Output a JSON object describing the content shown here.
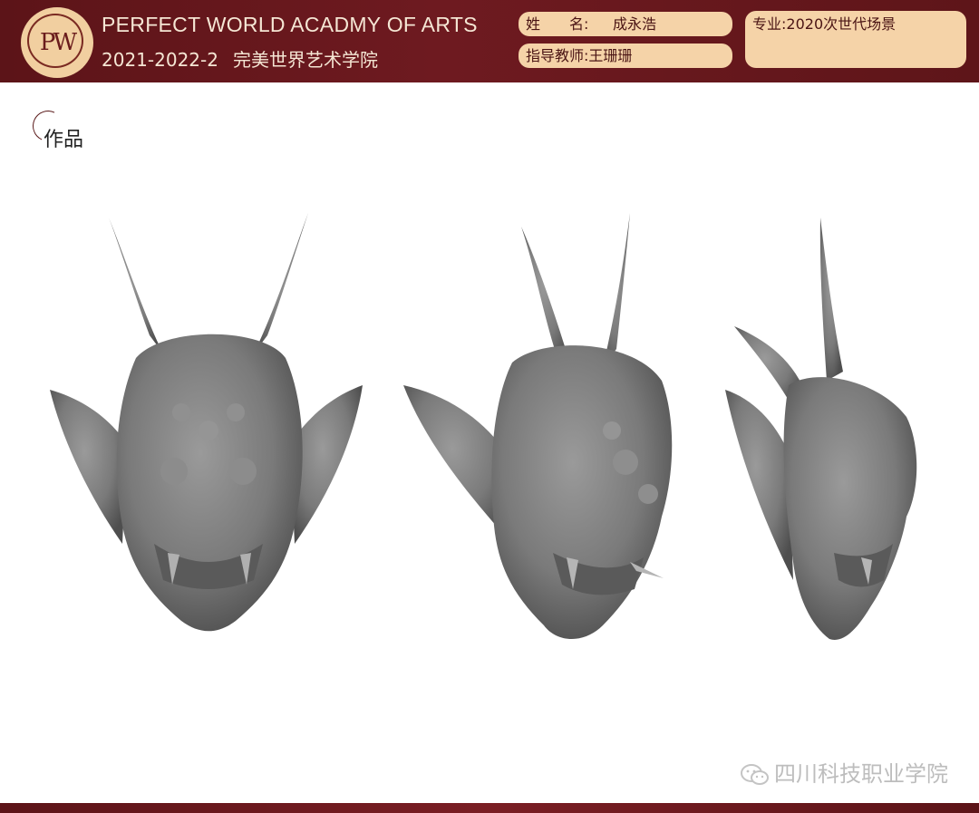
{
  "header": {
    "logo_text": "PW",
    "school_en": "PERFECT WORLD ACADMY OF ARTS",
    "term": "2021-2022-2",
    "school_cn": "完美世界艺术学院",
    "name_label": "姓　　名:",
    "name_value": "成永浩",
    "teacher_label": "指导教师:",
    "teacher_value": "王珊珊",
    "major_label": "专业:",
    "major_value": "2020次世代场景"
  },
  "section": {
    "title": "作品"
  },
  "works": {
    "views": [
      "front-view",
      "three-quarter-view",
      "side-view"
    ],
    "model_color": "#7c7c7c"
  },
  "watermark": {
    "text": "四川科技职业学院",
    "icon": "wechat-icon"
  },
  "colors": {
    "brand_dark": "#6e1a20",
    "pill_bg": "#f5d3a8"
  }
}
